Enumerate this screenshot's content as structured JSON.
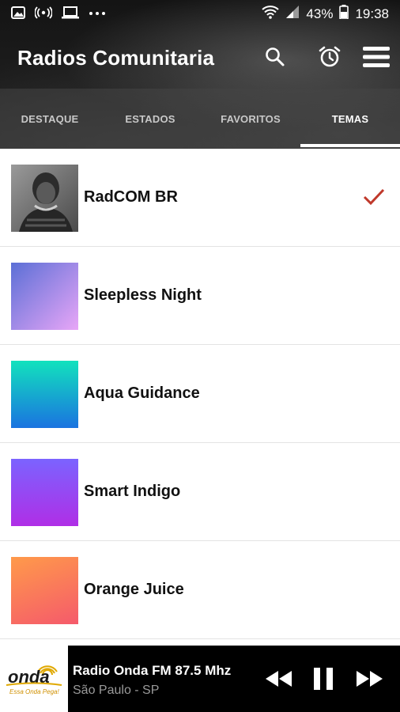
{
  "statusbar": {
    "battery": "43%",
    "time": "19:38",
    "icons": [
      "image-icon",
      "broadcast-icon",
      "laptop-icon",
      "more-dots-icon",
      "wifi-icon",
      "signal-icon",
      "battery-icon"
    ]
  },
  "appbar": {
    "title": "Radios Comunitaria",
    "icons": [
      "search-icon",
      "alarm-icon",
      "menu-icon"
    ]
  },
  "tabs": [
    {
      "label": "DESTAQUE",
      "active": false
    },
    {
      "label": "ESTADOS",
      "active": false
    },
    {
      "label": "FAVORITOS",
      "active": false
    },
    {
      "label": "TEMAS",
      "active": true
    }
  ],
  "themes": [
    {
      "label": "RadCOM BR",
      "selected": true,
      "colors": [
        "#3a3a3a",
        "#8a8a8a"
      ]
    },
    {
      "label": "Sleepless Night",
      "selected": false,
      "colors": [
        "#5b6fd6",
        "#e8a6f7"
      ]
    },
    {
      "label": "Aqua Guidance",
      "selected": false,
      "colors": [
        "#12e2bd",
        "#1a73e0"
      ]
    },
    {
      "label": "Smart Indigo",
      "selected": false,
      "colors": [
        "#7b63ff",
        "#b02ee6"
      ]
    },
    {
      "label": "Orange Juice",
      "selected": false,
      "colors": [
        "#ff9a4a",
        "#f55a6b"
      ]
    }
  ],
  "player": {
    "station": "Radio Onda FM 87.5 Mhz",
    "location": "São Paulo - SP",
    "logo_text": "onda",
    "logo_sub": "Essa Onda Pega!",
    "controls": [
      "rewind-icon",
      "pause-icon",
      "fast-forward-icon"
    ]
  },
  "colors": {
    "check": "#c0392b",
    "player_bg": "#000000"
  }
}
